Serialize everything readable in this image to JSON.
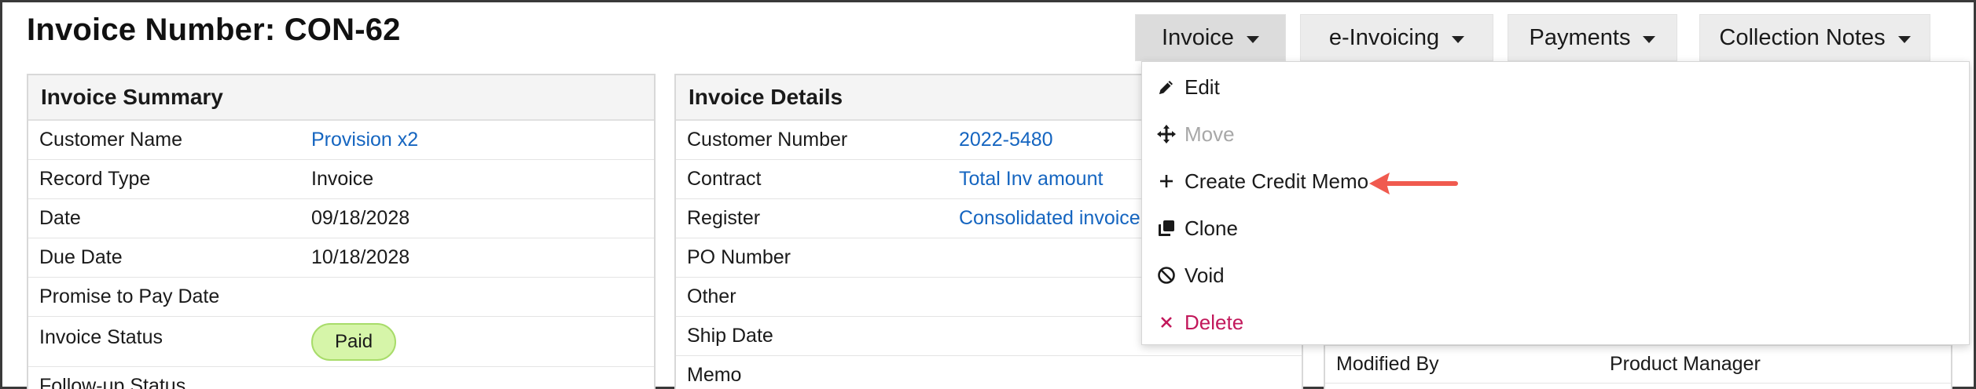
{
  "header": {
    "title": "Invoice Number: CON-62"
  },
  "toolbar": {
    "invoice_label": "Invoice",
    "einvoicing_label": "e-Invoicing",
    "payments_label": "Payments",
    "collection_notes_label": "Collection Notes"
  },
  "invoice_summary": {
    "title": "Invoice Summary",
    "rows": [
      {
        "label": "Customer Name",
        "value": "Provision x2"
      },
      {
        "label": "Record Type",
        "value": "Invoice"
      },
      {
        "label": "Date",
        "value": "09/18/2028"
      },
      {
        "label": "Due Date",
        "value": "10/18/2028"
      },
      {
        "label": "Promise to Pay Date",
        "value": ""
      },
      {
        "label": "Invoice Status",
        "value": "Paid"
      },
      {
        "label": "Follow-up Status",
        "value": ""
      }
    ]
  },
  "invoice_details": {
    "title": "Invoice Details",
    "rows": [
      {
        "label": "Customer Number",
        "value": "2022-5480"
      },
      {
        "label": "Contract",
        "value": "Total Inv amount"
      },
      {
        "label": "Register",
        "value": "Consolidated invoice"
      },
      {
        "label": "PO Number",
        "value": ""
      },
      {
        "label": "Other",
        "value": ""
      },
      {
        "label": "Ship Date",
        "value": ""
      },
      {
        "label": "Memo",
        "value": ""
      }
    ]
  },
  "record_info": {
    "modified_by_label": "Modified By",
    "modified_by_value": "Product Manager"
  },
  "invoice_menu": {
    "items": [
      {
        "label": "Edit",
        "icon": "pencil-icon"
      },
      {
        "label": "Move",
        "icon": "move-icon"
      },
      {
        "label": "Create Credit Memo",
        "icon": "plus-icon"
      },
      {
        "label": "Clone",
        "icon": "clone-icon"
      },
      {
        "label": "Void",
        "icon": "ban-icon"
      },
      {
        "label": "Delete",
        "icon": "x-icon"
      }
    ]
  },
  "colors": {
    "link": "#1565c0",
    "paid_badge_bg": "#d6f5a9",
    "delete": "#c2185b",
    "annotation_arrow": "#f05a4f"
  }
}
